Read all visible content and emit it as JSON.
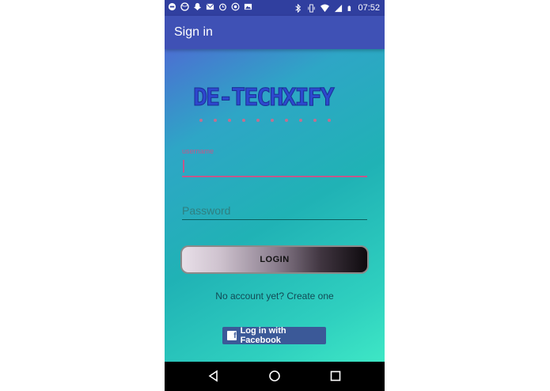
{
  "status_bar": {
    "time": "07:52",
    "icons": [
      "debug-icon",
      "dribbble-icon",
      "snapchat-icon",
      "gmail-icon",
      "alarm-icon",
      "whatsapp-icon",
      "photo-icon",
      "bluetooth-icon",
      "vibrate-icon",
      "wifi-icon",
      "signal-icon",
      "battery-icon"
    ]
  },
  "app_bar": {
    "title": "Sign in"
  },
  "logo": {
    "text": "DE-TECHXIFY"
  },
  "form": {
    "username_label": "username",
    "username_value": "",
    "password_placeholder": "Password",
    "login_label": "LOGIN",
    "signup_text": "No account yet? Create one",
    "facebook_label": "Log in with Facebook"
  },
  "colors": {
    "status_bar": "#303f9f",
    "app_bar": "#3f51b5",
    "accent": "#c2588a",
    "facebook": "#3b5998"
  }
}
